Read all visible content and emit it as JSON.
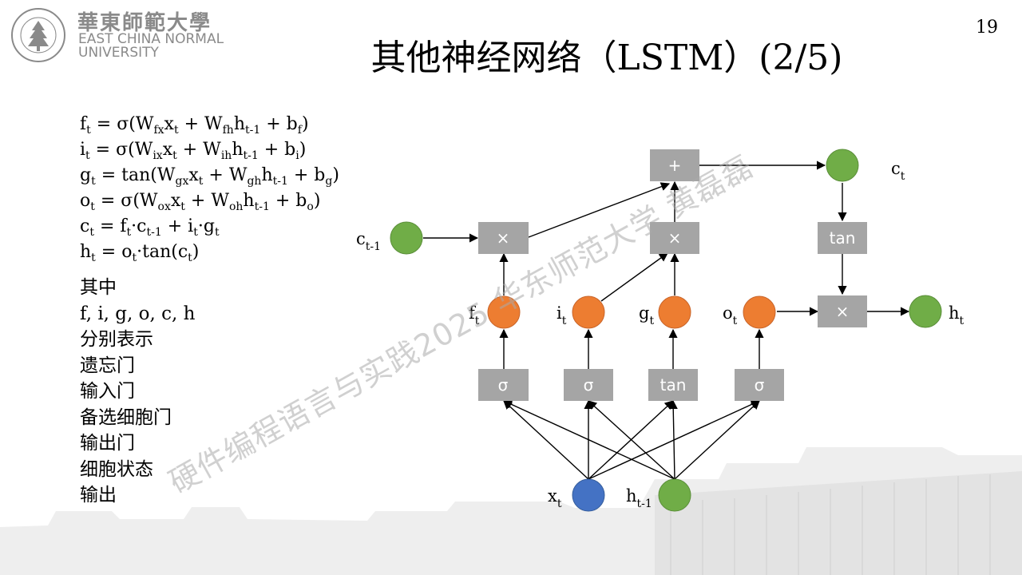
{
  "header": {
    "university_cn": "華東師範大學",
    "university_en_line1": "EAST CHINA NORMAL",
    "university_en_line2": "UNIVERSITY",
    "seal_text": "EAST CHINA NORMAL UNIVERSITY",
    "title_cn": "其他神经网络",
    "title_en": "（LSTM）(2/5)",
    "page_number": "19"
  },
  "equations": [
    {
      "lhs": "f",
      "lhs_sub": "t",
      "text": " = σ(W",
      "s1": "fx",
      "t2": "x",
      "s2": "t",
      "t3": " + W",
      "s3": "fh",
      "t4": "h",
      "s4": "t-1",
      "t5": " + b",
      "s5": "f",
      "t6": ")"
    },
    {
      "lhs": "i",
      "lhs_sub": "t",
      "text": " = σ(W",
      "s1": "ix",
      "t2": "x",
      "s2": "t",
      "t3": " + W",
      "s3": "ih",
      "t4": "h",
      "s4": "t-1",
      "t5": " + b",
      "s5": "i",
      "t6": ")"
    },
    {
      "lhs": "g",
      "lhs_sub": "t",
      "text": " = tan(W",
      "s1": "gx",
      "t2": "x",
      "s2": "t",
      "t3": " + W",
      "s3": "gh",
      "t4": "h",
      "s4": "t-1",
      "t5": " + b",
      "s5": "g",
      "t6": ")"
    },
    {
      "lhs": "o",
      "lhs_sub": "t",
      "text": " = σ(W",
      "s1": "ox",
      "t2": "x",
      "s2": "t",
      "t3": " + W",
      "s3": "oh",
      "t4": "h",
      "s4": "t-1",
      "t5": " + b",
      "s5": "o",
      "t6": ")"
    }
  ],
  "eq_c": {
    "a": "c",
    "a_sub": "t",
    "b": " = f",
    "b_sub": "t",
    "c": "·c",
    "c_sub": "t-1",
    "d": " + i",
    "d_sub": "t",
    "e": "·g",
    "e_sub": "t"
  },
  "eq_h": {
    "a": "h",
    "a_sub": "t",
    "b": " = o",
    "b_sub": "t",
    "c": "·tan(c",
    "c_sub": "t",
    "d": ")"
  },
  "notes": [
    "其中",
    "f, i, g, o, c, h",
    "分别表示",
    "遗忘门",
    "输入门",
    "备选细胞门",
    "输出门",
    "细胞状态",
    "输出"
  ],
  "watermark": "硬件编程语言与实践2025 华东师范大学 黄磊磊",
  "diagram": {
    "boxes": {
      "plus": "+",
      "mul_f": "×",
      "mul_i": "×",
      "mul_o": "×",
      "tan_c": "tan",
      "sig_f": "σ",
      "sig_i": "σ",
      "tan_g": "tan",
      "sig_o": "σ"
    },
    "labels": {
      "c_prev": {
        "base": "c",
        "sub": "t-1"
      },
      "c_t": {
        "base": "c",
        "sub": "t"
      },
      "h_t": {
        "base": "h",
        "sub": "t"
      },
      "f_t": {
        "base": "f",
        "sub": "t"
      },
      "i_t": {
        "base": "i",
        "sub": "t"
      },
      "g_t": {
        "base": "g",
        "sub": "t"
      },
      "o_t": {
        "base": "o",
        "sub": "t"
      },
      "x_t": {
        "base": "x",
        "sub": "t"
      },
      "h_prev": {
        "base": "h",
        "sub": "t-1"
      }
    },
    "colors": {
      "green": "#70ad47",
      "orange": "#ed7d31",
      "blue": "#4472c4",
      "box": "#a5a5a5"
    }
  }
}
